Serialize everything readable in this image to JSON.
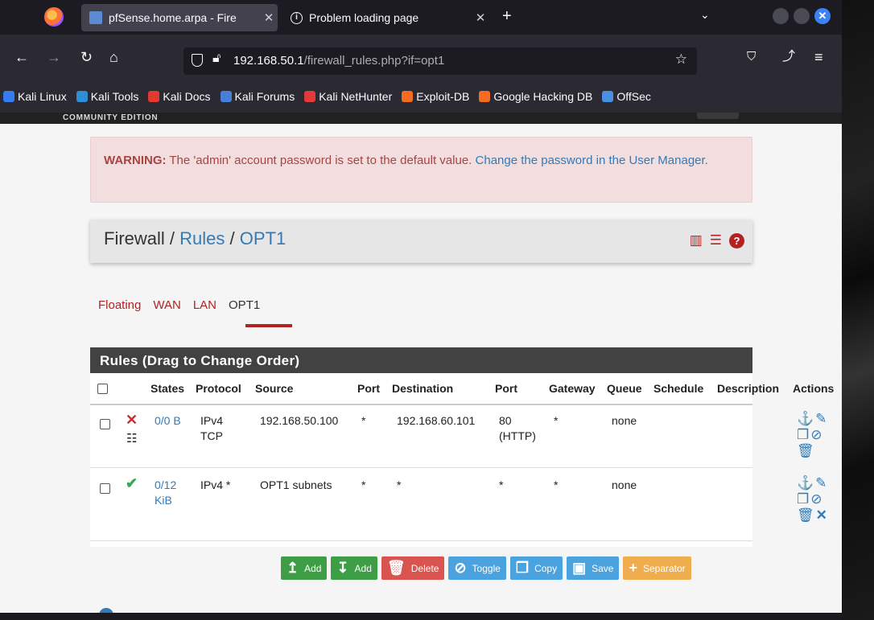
{
  "browser": {
    "tabs": [
      {
        "title": "pfSense.home.arpa - Fire",
        "active": true
      },
      {
        "title": "Problem loading page",
        "active": false
      }
    ],
    "url_host": "192.168.50.1",
    "url_path": "/firewall_rules.php?if=opt1",
    "bookmarks": [
      {
        "label": "Kali Linux",
        "color": "#367bf0"
      },
      {
        "label": "Kali Tools",
        "color": "#2f8fd5"
      },
      {
        "label": "Kali Docs",
        "color": "#e2392f"
      },
      {
        "label": "Kali Forums",
        "color": "#4a7fd9"
      },
      {
        "label": "Kali NetHunter",
        "color": "#e23a3a"
      },
      {
        "label": "Exploit-DB",
        "color": "#f26d21"
      },
      {
        "label": "Google Hacking DB",
        "color": "#f26d21"
      },
      {
        "label": "OffSec",
        "color": "#4a90e2"
      }
    ]
  },
  "header": {
    "edition": "COMMUNITY EDITION"
  },
  "warning": {
    "label": "WARNING:",
    "text": " The 'admin' account password is set to the default value. ",
    "link": "Change the password in the User Manager."
  },
  "breadcrumb": {
    "part1": "Firewall",
    "sep": "/",
    "part2": "Rules",
    "part3": "OPT1"
  },
  "tabs": [
    "Floating",
    "WAN",
    "LAN",
    "OPT1"
  ],
  "panel": {
    "title": "Rules (Drag to Change Order)",
    "headers": {
      "states": "States",
      "protocol": "Protocol",
      "source": "Source",
      "port": "Port",
      "destination": "Destination",
      "dport": "Port",
      "gateway": "Gateway",
      "queue": "Queue",
      "schedule": "Schedule",
      "description": "Description",
      "actions": "Actions"
    },
    "rows": [
      {
        "states": "0/0 B",
        "states2": "",
        "protocol": "IPv4",
        "protocol2": "TCP",
        "source": "192.168.50.100",
        "port": "*",
        "destination": "192.168.60.101",
        "dport": "80",
        "dport2": "(HTTP)",
        "gateway": "*",
        "queue": "none",
        "schedule": "",
        "description": "",
        "status": "block"
      },
      {
        "states": "0/12",
        "states2": "KiB",
        "protocol": "IPv4 *",
        "protocol2": "",
        "source": "OPT1 subnets",
        "port": "*",
        "destination": "*",
        "dport": "*",
        "dport2": "",
        "gateway": "*",
        "queue": "none",
        "schedule": "",
        "description": "",
        "status": "pass"
      }
    ]
  },
  "buttons": {
    "add_top": "Add",
    "add_bottom": "Add",
    "delete": "Delete",
    "toggle": "Toggle",
    "copy": "Copy",
    "save": "Save",
    "separator": "Separator"
  }
}
